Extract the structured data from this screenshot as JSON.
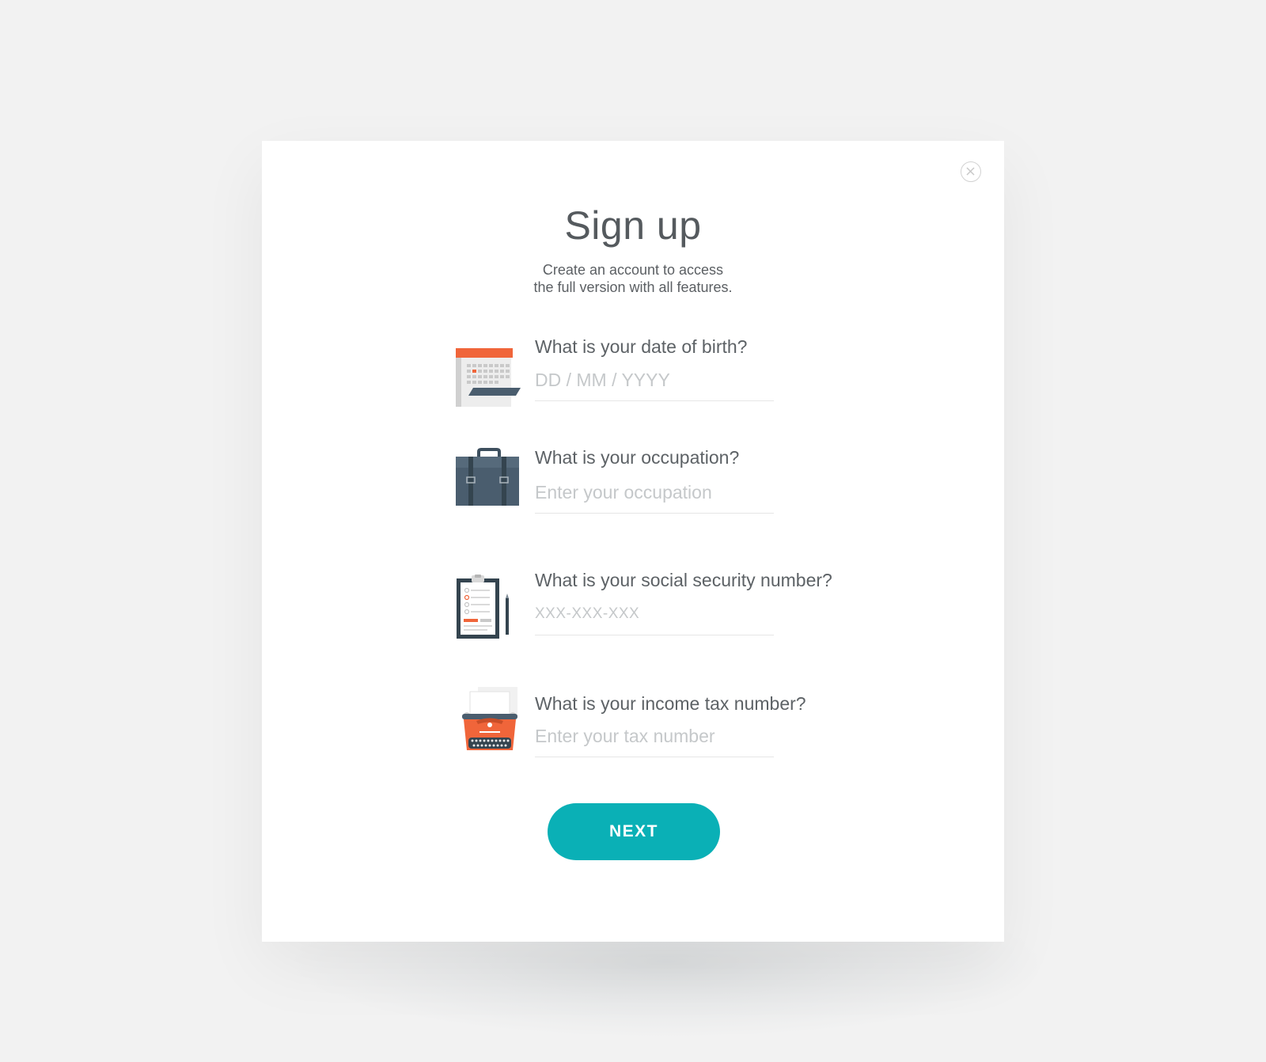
{
  "modal": {
    "title": "Sign up",
    "subtitle_line1": "Create an account to access",
    "subtitle_line2": "the full version with all features."
  },
  "fields": [
    {
      "label": "What is your date of birth?",
      "placeholder": "DD / MM / YYYY",
      "icon": "calendar-icon"
    },
    {
      "label": "What is your occupation?",
      "placeholder": "Enter your occupation",
      "icon": "briefcase-icon"
    },
    {
      "label": "What is your social security number?",
      "placeholder": "XXX-XXX-XXX",
      "icon": "clipboard-icon"
    },
    {
      "label": "What is your income tax number?",
      "placeholder": "Enter your tax number",
      "icon": "typewriter-icon"
    }
  ],
  "actions": {
    "next_label": "NEXT",
    "close_icon": "close-icon"
  },
  "colors": {
    "accent": "#0ab0b6",
    "orange": "#f0653a",
    "slate": "#4a5d6e",
    "background": "#f2f2f2"
  }
}
